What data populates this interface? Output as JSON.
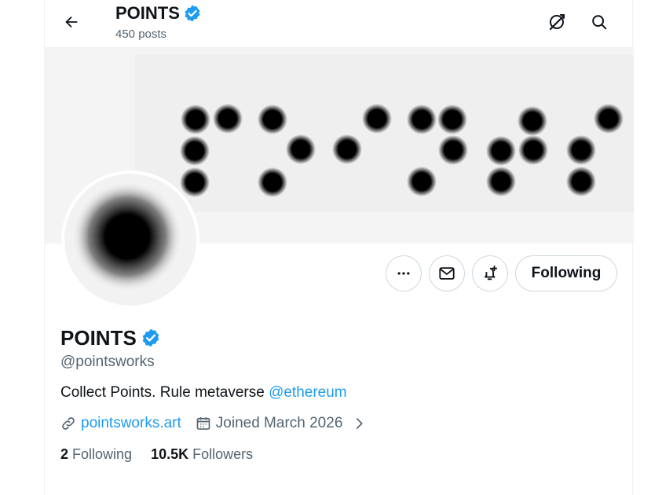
{
  "header": {
    "title": "POINTS",
    "post_count": "450 posts"
  },
  "profile": {
    "display_name": "POINTS",
    "handle": "@pointsworks",
    "bio_text": "Collect Points. Rule metaverse ",
    "bio_mention": "@ethereum",
    "website": "pointsworks.art",
    "joined": "Joined March 2026",
    "following_count": "2",
    "following_label": "Following",
    "followers_count": "10.5K",
    "followers_label": "Followers"
  },
  "actions": {
    "follow_label": "Following"
  },
  "icons": {
    "back": "arrow-left-icon",
    "grok": "grok-icon",
    "search": "search-icon",
    "more": "more-icon",
    "message": "mail-icon",
    "notify": "bell-plus-icon",
    "verified": "verified-badge-icon",
    "link": "link-icon",
    "calendar": "calendar-icon",
    "chevron": "chevron-right-icon"
  },
  "colors": {
    "accent": "#1d9bf0",
    "text": "#0f1419",
    "muted": "#536471",
    "border": "#cfd9de"
  }
}
